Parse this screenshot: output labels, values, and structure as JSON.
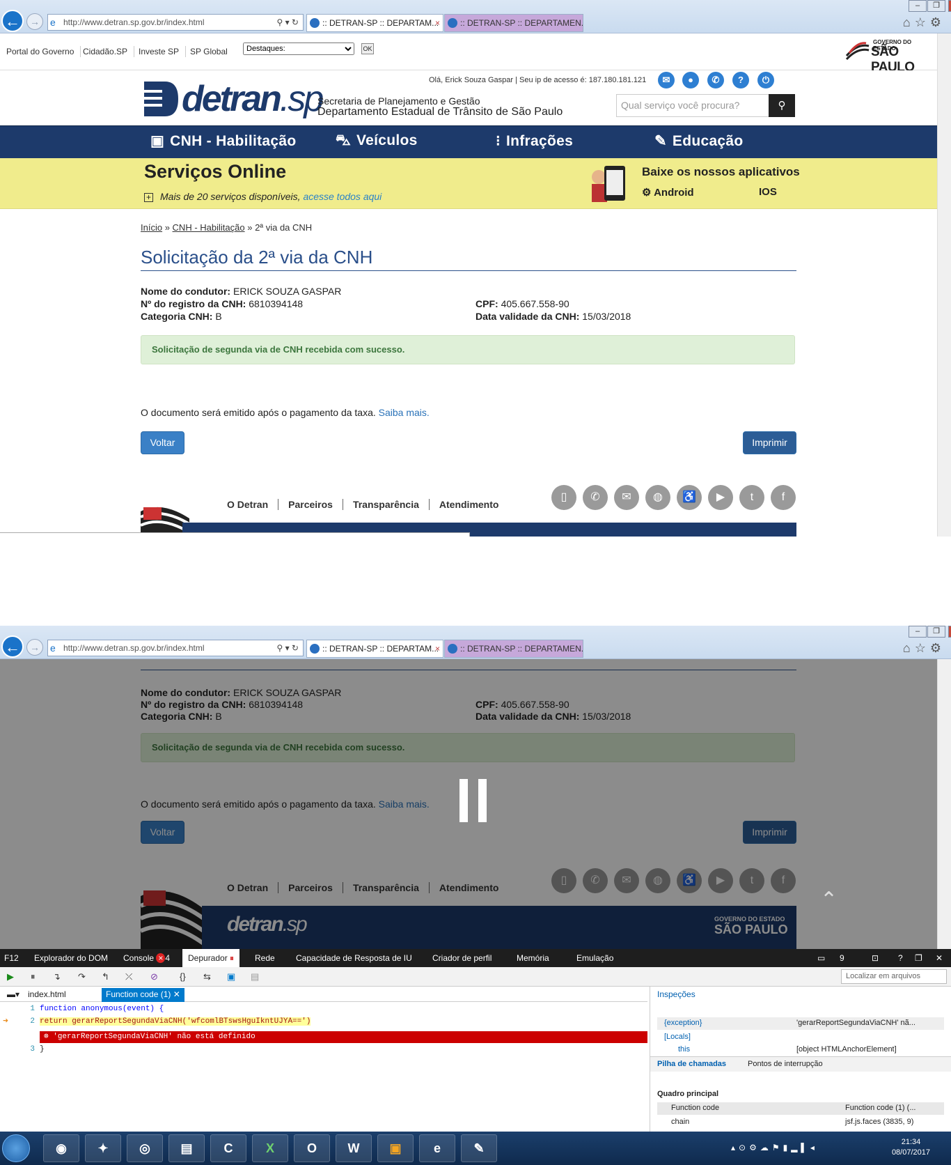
{
  "browser": {
    "url": "http://www.detran.sp.gov.br/index.html",
    "tabs": [
      {
        "label": ":: DETRAN-SP :: DEPARTAM..."
      },
      {
        "label": ":: DETRAN-SP :: DEPARTAMEN..."
      }
    ]
  },
  "gov_bar": {
    "links": [
      "Portal do Governo",
      "Cidadão.SP",
      "Investe SP",
      "SP Global"
    ],
    "select_value": "Destaques:",
    "ok_label": "OK",
    "logo_top": "GOVERNO DO ESTADO",
    "logo_main": "SÃO PAULO"
  },
  "header": {
    "logo_text_bold": "detran",
    "logo_text_light": ".sp",
    "secretaria": "Secretaria de Planejamento e Gestão",
    "departamento": "Departamento Estadual de Trânsito de São Paulo",
    "greeting": "Olá, Erick Souza Gaspar | Seu ip de acesso é: 187.180.181.121",
    "search_placeholder": "Qual serviço você procura?"
  },
  "nav": {
    "items": [
      "CNH - Habilitação",
      "Veículos",
      "Infrações",
      "Educação"
    ]
  },
  "services": {
    "title": "Serviços Online",
    "subtitle": "Mais de 20 serviços disponíveis,",
    "link": "acesse todos aqui",
    "apps_title": "Baixe os nossos aplicativos",
    "android": "Android",
    "ios": "IOS"
  },
  "breadcrumb": {
    "home": "Início",
    "section": "CNH - Habilitação",
    "current": "2ª via da CNH"
  },
  "page": {
    "title": "Solicitação da 2ª via da CNH",
    "driver_label": "Nome do condutor:",
    "driver_value": "ERICK SOUZA GASPAR",
    "reg_label": "Nº do registro da CNH:",
    "reg_value": "6810394148",
    "cat_label": "Categoria CNH:",
    "cat_value": "B",
    "cpf_label": "CPF:",
    "cpf_value": "405.667.558-90",
    "validity_label": "Data validade da CNH:",
    "validity_value": "15/03/2018",
    "success": "Solicitação de segunda via de CNH recebida com sucesso.",
    "doc_text": "O documento será emitido após o pagamento da taxa.",
    "doc_link": "Saiba mais.",
    "back_button": "Voltar",
    "print_button": "Imprimir"
  },
  "footer": {
    "links": [
      "O Detran",
      "Parceiros",
      "Transparência",
      "Atendimento"
    ],
    "logo_bold": "detran",
    "logo_light": ".sp",
    "gov_top": "GOVERNO DO ESTADO",
    "gov_main": "SÃO PAULO"
  },
  "devtools": {
    "f12": "F12",
    "tabs": [
      "Explorador do DOM",
      "Console",
      "Depurador",
      "Rede",
      "Capacidade de Resposta de IU",
      "Criador de perfil",
      "Memória",
      "Emulação"
    ],
    "console_errors": "4",
    "count_right": "9",
    "find_placeholder": "Localizar em arquivos",
    "file_tabs": [
      "index.html",
      "Function code (1)"
    ],
    "code_lines": [
      {
        "num": "1",
        "text": "function anonymous(event) {"
      },
      {
        "num": "2",
        "text": "return gerarReportSegundaViaCNH('wfcomlBTswsHguIkntUJYA==')"
      },
      {
        "num": "3",
        "text": "}"
      }
    ],
    "error_message": "'gerarReportSegundaViaCNH' não está definido",
    "watch_title": "Inspeções",
    "watch": [
      {
        "name": "{exception}",
        "value": "'gerarReportSegundaViaCNH' nã..."
      },
      {
        "name": "[Locals]",
        "value": ""
      },
      {
        "name": "this",
        "value": "[object HTMLAnchorElement]"
      }
    ],
    "stack_tab": "Pilha de chamadas",
    "breakpoints_tab": "Pontos de interrupção",
    "frame_title": "Quadro principal",
    "stack": [
      {
        "name": "Function code",
        "value": "Function code (1) (..."
      },
      {
        "name": "chain",
        "value": "jsf.js.faces (3835, 9)"
      }
    ]
  },
  "taskbar": {
    "time": "21:34",
    "date": "08/07/2017"
  }
}
